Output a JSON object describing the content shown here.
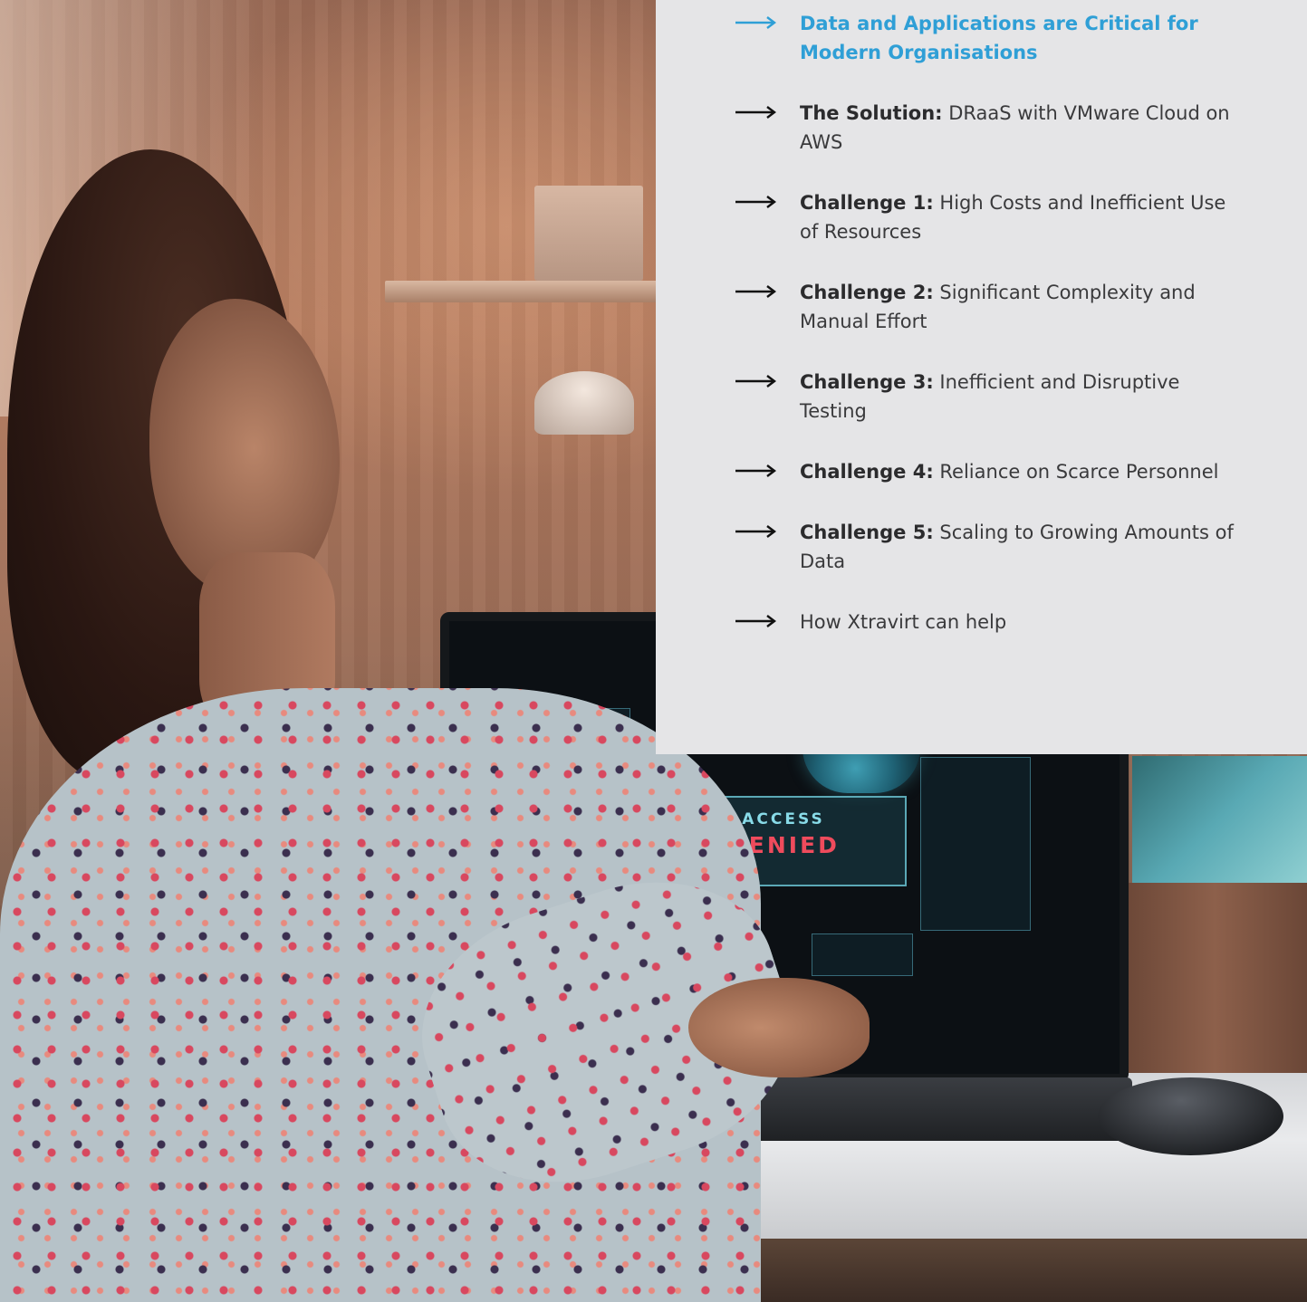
{
  "colors": {
    "panel_background": "#e5e5e7",
    "active_accent": "#2f9fd6",
    "text": "#3a3a3c",
    "arrow": "#111111"
  },
  "screen": {
    "access_word": "ACCESS",
    "denied_word": "DENIED"
  },
  "toc": {
    "items": [
      {
        "label": "",
        "text": "Data and Applications are Critical for Modern Organisations",
        "active": true
      },
      {
        "label": "The Solution:",
        "text": "DRaaS with VMware Cloud on AWS",
        "active": false
      },
      {
        "label": "Challenge 1:",
        "text": "High Costs and Inefficient Use of Resources",
        "active": false
      },
      {
        "label": "Challenge 2:",
        "text": "Significant Complexity and Manual Effort",
        "active": false
      },
      {
        "label": "Challenge 3:",
        "text": "Inefficient and Disruptive Testing",
        "active": false
      },
      {
        "label": "Challenge 4:",
        "text": "Reliance on Scarce Personnel",
        "active": false
      },
      {
        "label": "Challenge 5:",
        "text": "Scaling to Growing Amounts of Data",
        "active": false
      },
      {
        "label": "",
        "text": "How Xtravirt can help",
        "active": false
      }
    ]
  }
}
